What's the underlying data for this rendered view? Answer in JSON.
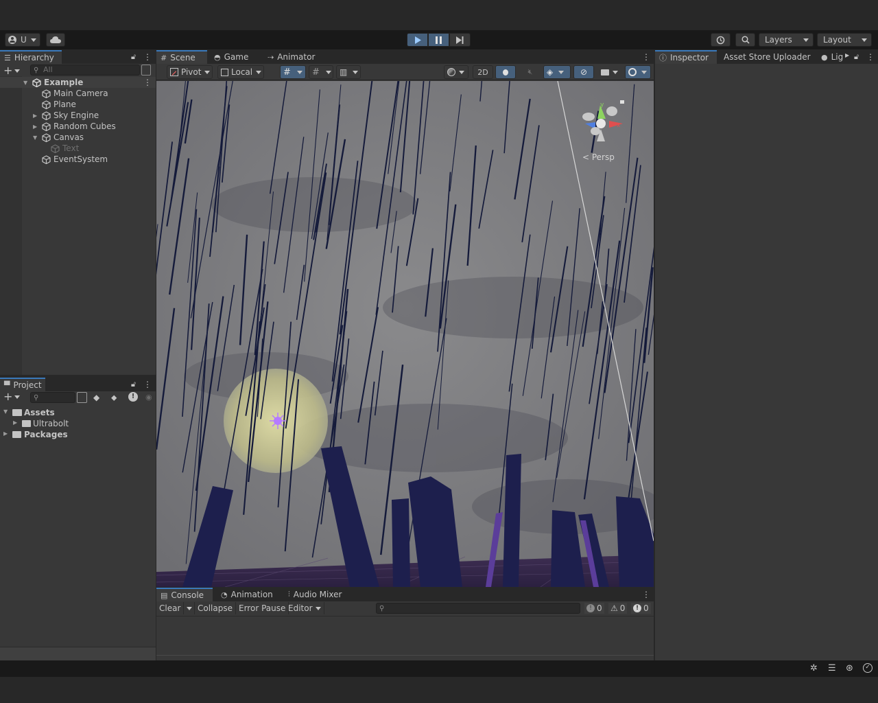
{
  "toolbar": {
    "account_label": "U",
    "layers_label": "Layers",
    "layout_label": "Layout"
  },
  "hierarchy": {
    "tab_label": "Hierarchy",
    "search_placeholder": "All",
    "root": "Example",
    "items": [
      {
        "label": "Main Camera",
        "expandable": false,
        "dim": false
      },
      {
        "label": "Plane",
        "expandable": false,
        "dim": false
      },
      {
        "label": "Sky Engine",
        "expandable": true,
        "dim": false
      },
      {
        "label": "Random Cubes",
        "expandable": true,
        "dim": false
      },
      {
        "label": "Canvas",
        "expandable": true,
        "expanded": true,
        "dim": false
      },
      {
        "label": "Text",
        "expandable": false,
        "dim": true
      },
      {
        "label": "EventSystem",
        "expandable": false,
        "dim": false
      }
    ]
  },
  "project": {
    "tab_label": "Project",
    "items": [
      {
        "label": "Assets"
      },
      {
        "label": "Ultrabolt"
      },
      {
        "label": "Packages"
      }
    ]
  },
  "scene": {
    "tabs": [
      "Scene",
      "Game",
      "Animator"
    ],
    "pivot_label": "Pivot",
    "local_label": "Local",
    "mode_2d_label": "2D",
    "persp_label": "< Persp",
    "gizmo_axes": [
      "y",
      "x"
    ]
  },
  "console": {
    "tabs": [
      "Console",
      "Animation",
      "Audio Mixer"
    ],
    "clear_label": "Clear",
    "collapse_label": "Collapse",
    "error_pause_label": "Error Pause",
    "editor_label": "Editor",
    "log_count": "0",
    "warning_count": "0",
    "error_count": "0"
  },
  "inspector": {
    "tabs": [
      "Inspector",
      "Asset Store Uploader",
      "Lig"
    ]
  },
  "colors": {
    "accent": "#3a79bb",
    "play_active": "#46607c",
    "panel": "#383838",
    "dark": "#191919"
  }
}
